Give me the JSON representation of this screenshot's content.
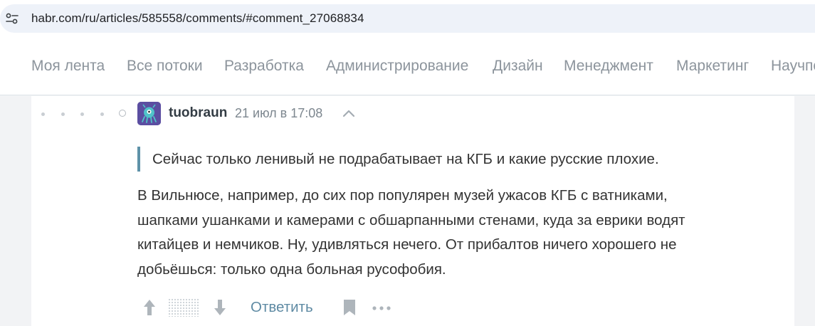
{
  "browser": {
    "url": "habr.com/ru/articles/585558/comments/#comment_27068834",
    "site_info_icon": "tune-icon"
  },
  "nav": {
    "items": [
      {
        "label": "Моя лента"
      },
      {
        "label": "Все потоки"
      },
      {
        "label": "Разработка"
      },
      {
        "label": "Администрирование"
      },
      {
        "label": "Дизайн"
      },
      {
        "label": "Менеджмент"
      },
      {
        "label": "Маркетинг"
      },
      {
        "label": "Научпоп"
      }
    ]
  },
  "comment": {
    "author": "tuobraun",
    "timestamp": "21 июл в 17:08",
    "quote": "Сейчас только ленивый не подрабатывает на КГБ и какие русские плохие.",
    "body_lines": [
      "В Вильнюсе, например, до сих пор популярен музей ужасов КГБ с ватниками,",
      "шапками ушанками и камерами с обшарпанными стенами, куда за еврики водят",
      "китайцев и немчиков. Ну, удивляться нечего. От прибалтов ничего хорошего не",
      "добьёшься: только одна больная русофобия."
    ],
    "actions": {
      "reply_label": "Ответить",
      "vote_up_icon": "arrow-up-icon",
      "vote_down_icon": "arrow-down-icon",
      "bookmark_icon": "bookmark-icon",
      "more_icon": "more-dots-icon"
    }
  },
  "colors": {
    "nav_text": "#8c949c",
    "link": "#5e8aa3",
    "quote_bar": "#5e92a8",
    "avatar_bg": "#5b4ea1"
  }
}
